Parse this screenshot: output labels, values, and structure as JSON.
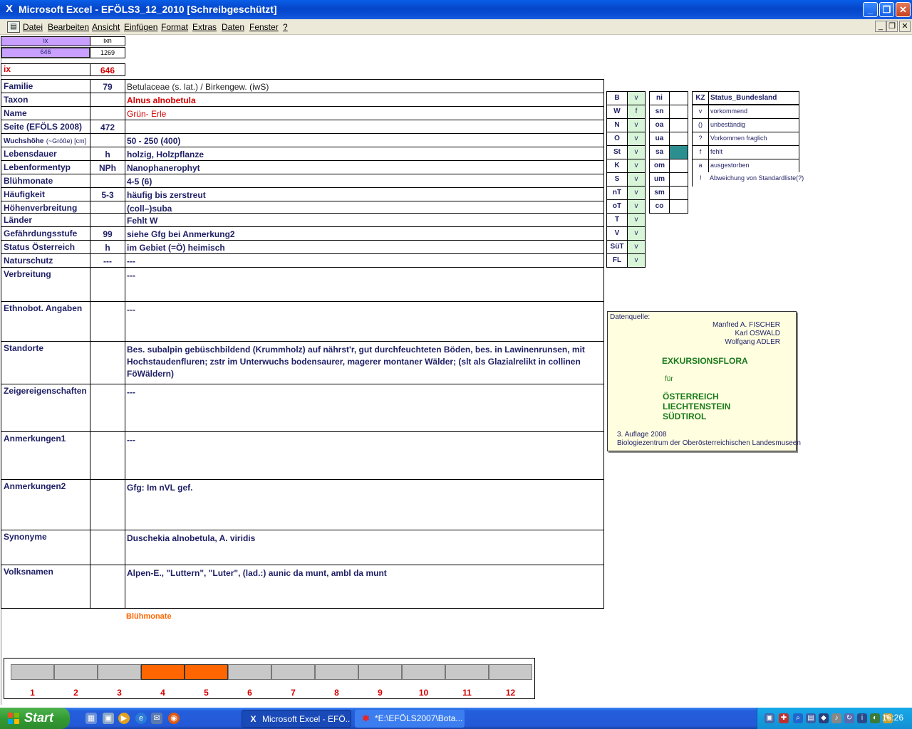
{
  "window": {
    "title": "Microsoft Excel - EFÖLS3_12_2010  [Schreibgeschützt]"
  },
  "menu": [
    "Datei",
    "Bearbeiten",
    "Ansicht",
    "Einfügen",
    "Format",
    "Extras",
    "Daten",
    "Fenster",
    "?"
  ],
  "top_cells": {
    "ix_head": "ix",
    "ixn_head": "ixn",
    "ix_val": "646",
    "ixn_val": "1269",
    "ix_label": "ix",
    "ix_big": "646"
  },
  "rows": [
    {
      "label": "Familie",
      "num": "79",
      "value": "Betulaceae (s. lat.)  /  Birkengew. (iwS)"
    },
    {
      "label": "Taxon",
      "num": "",
      "value": "Alnus alnobetula"
    },
    {
      "label": "Name",
      "num": "",
      "value": "Grün- Erle"
    },
    {
      "label": "Seite (EFÖLS 2008)",
      "num": "472",
      "value": ""
    },
    {
      "label": "Wuchshöhe",
      "label_small": "(~Größe) [cm]",
      "num": "",
      "value": " 50 - 250 (400)"
    },
    {
      "label": "Lebensdauer",
      "num": "h",
      "value": "holzig, Holzpflanze"
    },
    {
      "label": "Lebenformentyp",
      "num": "NPh",
      "value": "Nanophanerophyt"
    },
    {
      "label": "Blühmonate",
      "num": "",
      "value": " 4-5 (6)"
    },
    {
      "label": "Häufigkeit",
      "num": "5-3",
      "value": "häufig bis zerstreut"
    },
    {
      "label": "Höhenverbreitung",
      "num": "",
      "value": "(coll–)suba"
    },
    {
      "label": "Länder",
      "num": "",
      "value": "Fehlt W"
    },
    {
      "label": "Gefährdungsstufe",
      "num": "99",
      "value": "siehe Gfg bei Anmerkung2"
    },
    {
      "label": "Status Österreich",
      "num": "h",
      "value": "im Gebiet (=Ö) heimisch"
    },
    {
      "label": "Naturschutz",
      "num": "---",
      "value": "---"
    },
    {
      "label": "Verbreitung",
      "num": "",
      "value": "---"
    },
    {
      "label": "Ethnobot. Angaben",
      "num": "",
      "value": "---"
    },
    {
      "label": "Standorte",
      "num": "",
      "value": "Bes. subalpin gebüschbildend (Krummholz) auf nährst'r, gut durchfeuchteten Böden, bes. in Lawinenrunsen, mit Hochstaudenfluren; zstr im Unterwuchs bodensaurer, magerer montaner Wälder; (slt als Glazialrelikt in collinen FöWäldern)"
    },
    {
      "label": "Zeigereigenschaften",
      "num": "",
      "value": "---"
    },
    {
      "label": "Anmerkungen1",
      "num": "",
      "value": "---"
    },
    {
      "label": "Anmerkungen2",
      "num": "",
      "value": " Gfg: Im nVL gef."
    },
    {
      "label": "Synonyme",
      "num": "",
      "value": "Duschekia alnobetula, A. viridis"
    },
    {
      "label": "Volksnamen",
      "num": "",
      "value": "Alpen-E., \"Luttern\", \"Luter\",  (lad.:) aunic da munt, ambl da munt"
    }
  ],
  "states": [
    {
      "code": "B",
      "val": "v"
    },
    {
      "code": "W",
      "val": "f"
    },
    {
      "code": "N",
      "val": "v"
    },
    {
      "code": "O",
      "val": "v"
    },
    {
      "code": "St",
      "val": "v"
    },
    {
      "code": "K",
      "val": "v"
    },
    {
      "code": "S",
      "val": "v"
    },
    {
      "code": "nT",
      "val": "v"
    },
    {
      "code": "oT",
      "val": "v"
    },
    {
      "code": "T",
      "val": "v"
    },
    {
      "code": "V",
      "val": "v"
    },
    {
      "code": "SüT",
      "val": "v"
    },
    {
      "code": "FL",
      "val": "v"
    }
  ],
  "regions": [
    "ni",
    "sn",
    "oa",
    "ua",
    "sa",
    "om",
    "um",
    "sm",
    "co"
  ],
  "kz_table": {
    "head_kz": "KZ",
    "head_status": "Status_Bundesland",
    "rows": [
      {
        "kz": "v",
        "text": "vorkommend"
      },
      {
        "kz": "()",
        "text": "unbeständig"
      },
      {
        "kz": "?",
        "text": "Vorkommen fraglich"
      },
      {
        "kz": "f",
        "text": "fehlt"
      },
      {
        "kz": "a",
        "text": "ausgestorben"
      },
      {
        "kz": "!",
        "text": "Abweichung von Standardliste(?)"
      }
    ]
  },
  "source": {
    "label": "Datenquelle:",
    "author1": "Manfred A. FISCHER",
    "author2": "Karl OSWALD",
    "author3": "Wolfgang ADLER",
    "book": "EXKURSIONSFLORA",
    "fuer": "für",
    "land1": "ÖSTERREICH",
    "land2": "LIECHTENSTEIN",
    "land3": "SÜDTIROL",
    "edition": "3. Auflage 2008",
    "publisher": "Biologiezentrum der Oberösterreichischen Landesmuseen"
  },
  "chart_data": {
    "type": "bar",
    "title": "Blühmonate",
    "categories": [
      "1",
      "2",
      "3",
      "4",
      "5",
      "6",
      "7",
      "8",
      "9",
      "10",
      "11",
      "12"
    ],
    "values": [
      0,
      0,
      0,
      1,
      1,
      0,
      0,
      0,
      0,
      0,
      0,
      0
    ],
    "colors": {
      "on": "#ff6600",
      "off": "#c8c8c8"
    }
  },
  "taskbar": {
    "start": "Start",
    "tasks": [
      {
        "label": "Microsoft Excel - EFÖ..."
      },
      {
        "label": "*E:\\EFÖLS2007\\Bota..."
      }
    ],
    "clock": "16:26"
  }
}
